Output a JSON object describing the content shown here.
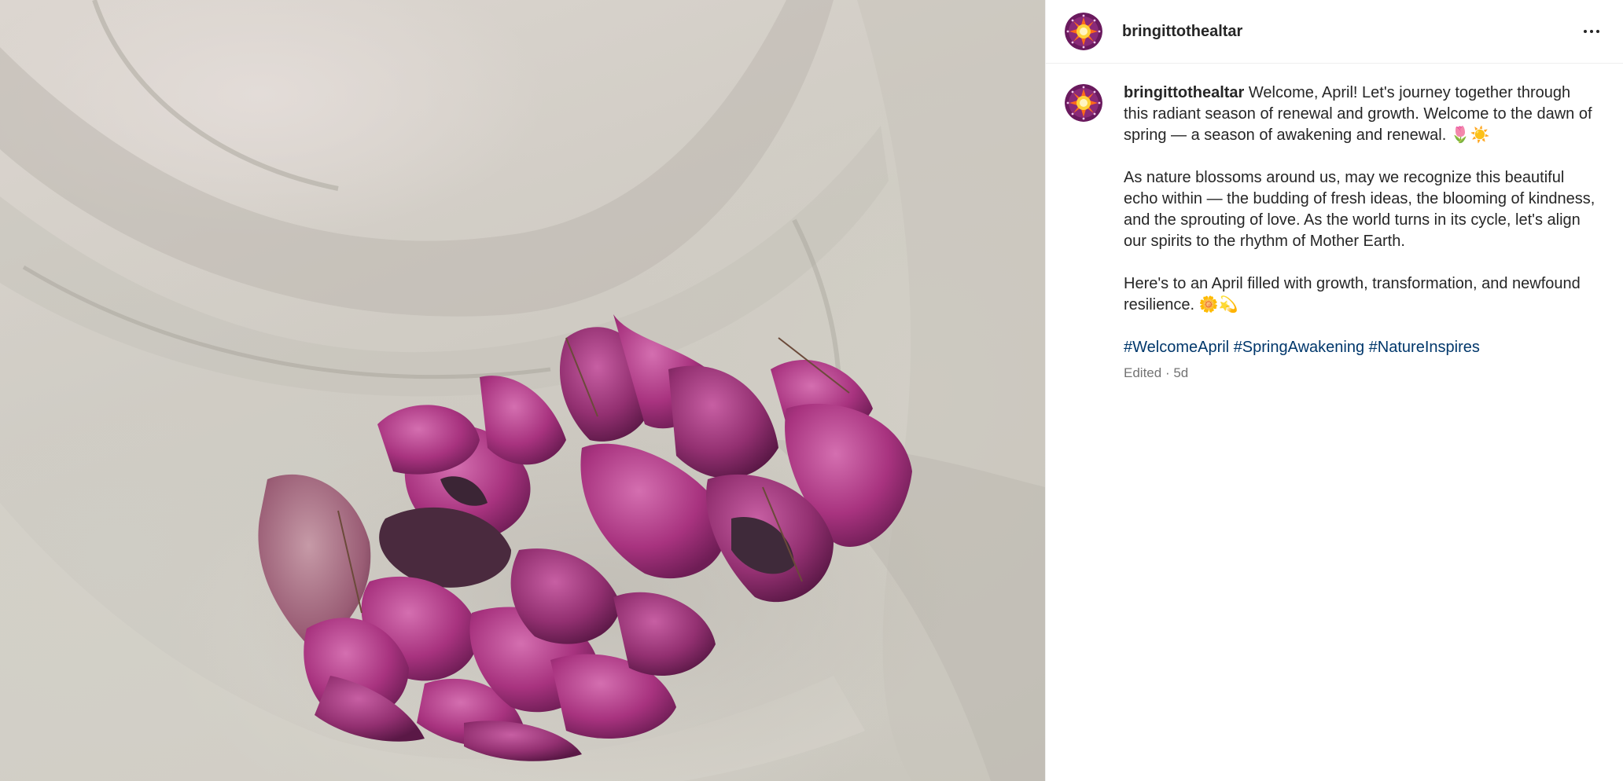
{
  "post": {
    "username": "bringittothealtar",
    "more_icon": "more-horizontal-icon",
    "caption": {
      "username": "bringittothealtar",
      "paragraphs": [
        "Welcome, April! Let's journey together through this radiant season of renewal and growth. Welcome to the dawn of spring — a season of awakening and renewal. 🌷☀️",
        "As nature blossoms around us, may we recognize this beautiful echo within — the budding of fresh ideas, the blooming of kindness, and the sprouting of love. As the world turns in its cycle, let's align our spirits to the rhythm of Mother Earth.",
        "Here's to an April filled with growth, transformation, and newfound resilience. 🌼💫"
      ],
      "hashtags": [
        "#WelcomeApril",
        "#SpringAwakening",
        "#NatureInspires"
      ]
    },
    "edited_label": "Edited",
    "separator": "·",
    "age": "5d"
  },
  "colors": {
    "hashtag": "#00376b",
    "meta_text": "#737373",
    "username_text": "#262626",
    "petal": "#a8337f"
  }
}
